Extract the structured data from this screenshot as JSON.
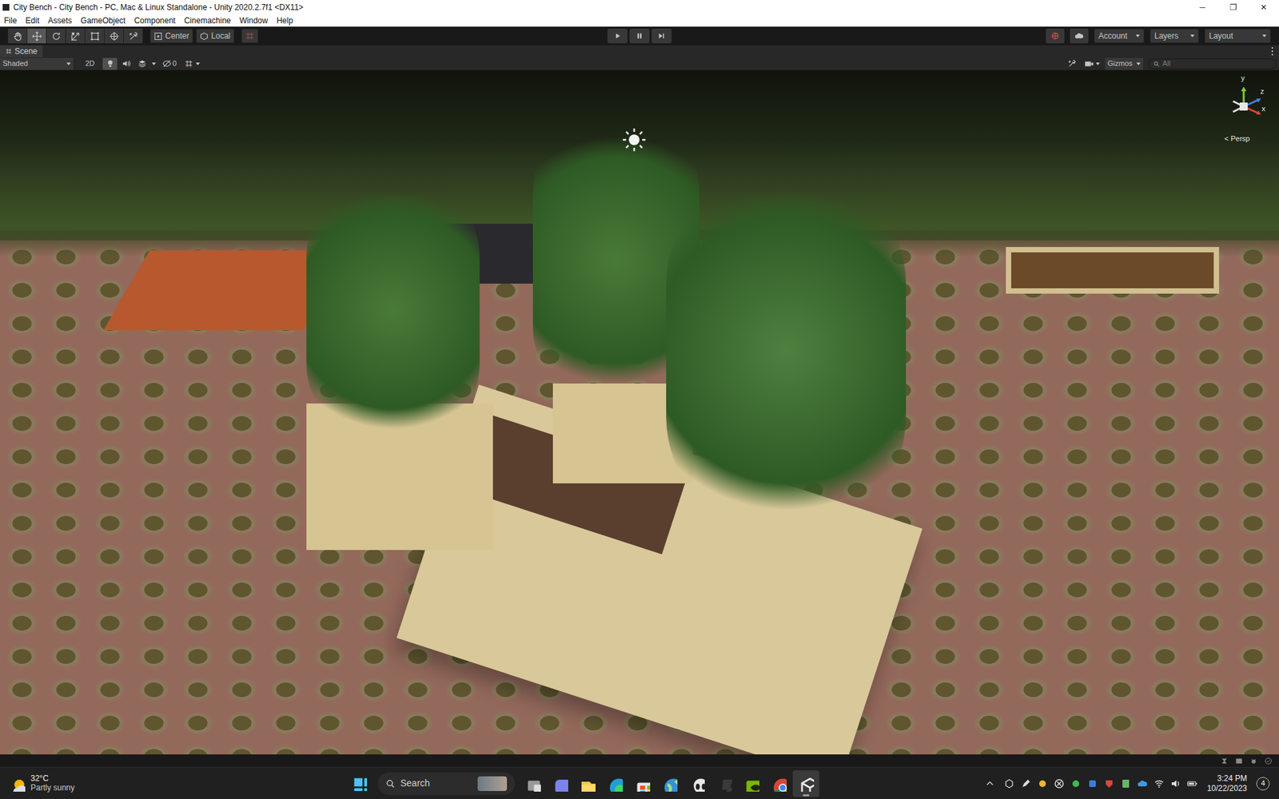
{
  "window": {
    "title": "City Bench - City Bench - PC, Mac & Linux Standalone - Unity 2020.2.7f1 <DX11>",
    "controls": [
      {
        "label": "─"
      },
      {
        "label": "❐"
      },
      {
        "label": "✕"
      }
    ]
  },
  "menu": [
    "File",
    "Edit",
    "Assets",
    "GameObject",
    "Component",
    "Cinemachine",
    "Window",
    "Help"
  ],
  "toolbar": {
    "tools": [
      {
        "kind": "hand",
        "selected": false
      },
      {
        "kind": "move",
        "selected": true
      },
      {
        "kind": "rotate",
        "selected": false
      },
      {
        "kind": "scale",
        "selected": false
      },
      {
        "kind": "rect",
        "selected": false
      },
      {
        "kind": "transform",
        "selected": false
      },
      {
        "kind": "custom",
        "selected": false
      }
    ],
    "pivot": [
      {
        "label": "Center",
        "kind": "center"
      },
      {
        "label": "Local",
        "kind": "local"
      }
    ],
    "playback": [
      {
        "kind": "play",
        "selected": false
      },
      {
        "kind": "pause",
        "selected": false
      },
      {
        "kind": "step",
        "selected": false
      }
    ],
    "right": [
      "Account",
      "Layers",
      "Layout"
    ]
  },
  "scene": {
    "tab": "Scene",
    "shading": "Shaded",
    "mode2d": {
      "label": "2D",
      "selected": false
    },
    "toggles": [
      {
        "kind": "lighting",
        "selected": true
      },
      {
        "kind": "audio",
        "selected": false
      },
      {
        "kind": "effects",
        "selected": false
      }
    ],
    "hidden": "0",
    "gizmos": "Gizmos",
    "search": {
      "placeholder": "All"
    },
    "axes": [
      "y",
      "z",
      "x"
    ],
    "projection": "< Persp"
  },
  "taskbar": {
    "weather": {
      "temp": "32°C",
      "text": "Partly sunny"
    },
    "search": "Search",
    "apps": [
      {
        "kind": "taskview",
        "selected": false
      },
      {
        "kind": "teams",
        "selected": false
      },
      {
        "kind": "explorer",
        "selected": false
      },
      {
        "kind": "edge",
        "selected": false
      },
      {
        "kind": "store",
        "selected": false
      },
      {
        "kind": "globe",
        "selected": false
      },
      {
        "kind": "ghost",
        "selected": false
      },
      {
        "kind": "dark",
        "selected": false
      },
      {
        "kind": "nvidia",
        "selected": false
      },
      {
        "kind": "chrome",
        "selected": false
      },
      {
        "kind": "unity",
        "selected": true
      }
    ],
    "tray": [
      "unity",
      "pen",
      "yellow",
      "xbox",
      "green",
      "blue",
      "red",
      "notes",
      "cloud",
      "wifi",
      "speaker",
      "battery"
    ],
    "time": "3:24 PM",
    "date": "10/22/2023",
    "notifications": "4"
  }
}
